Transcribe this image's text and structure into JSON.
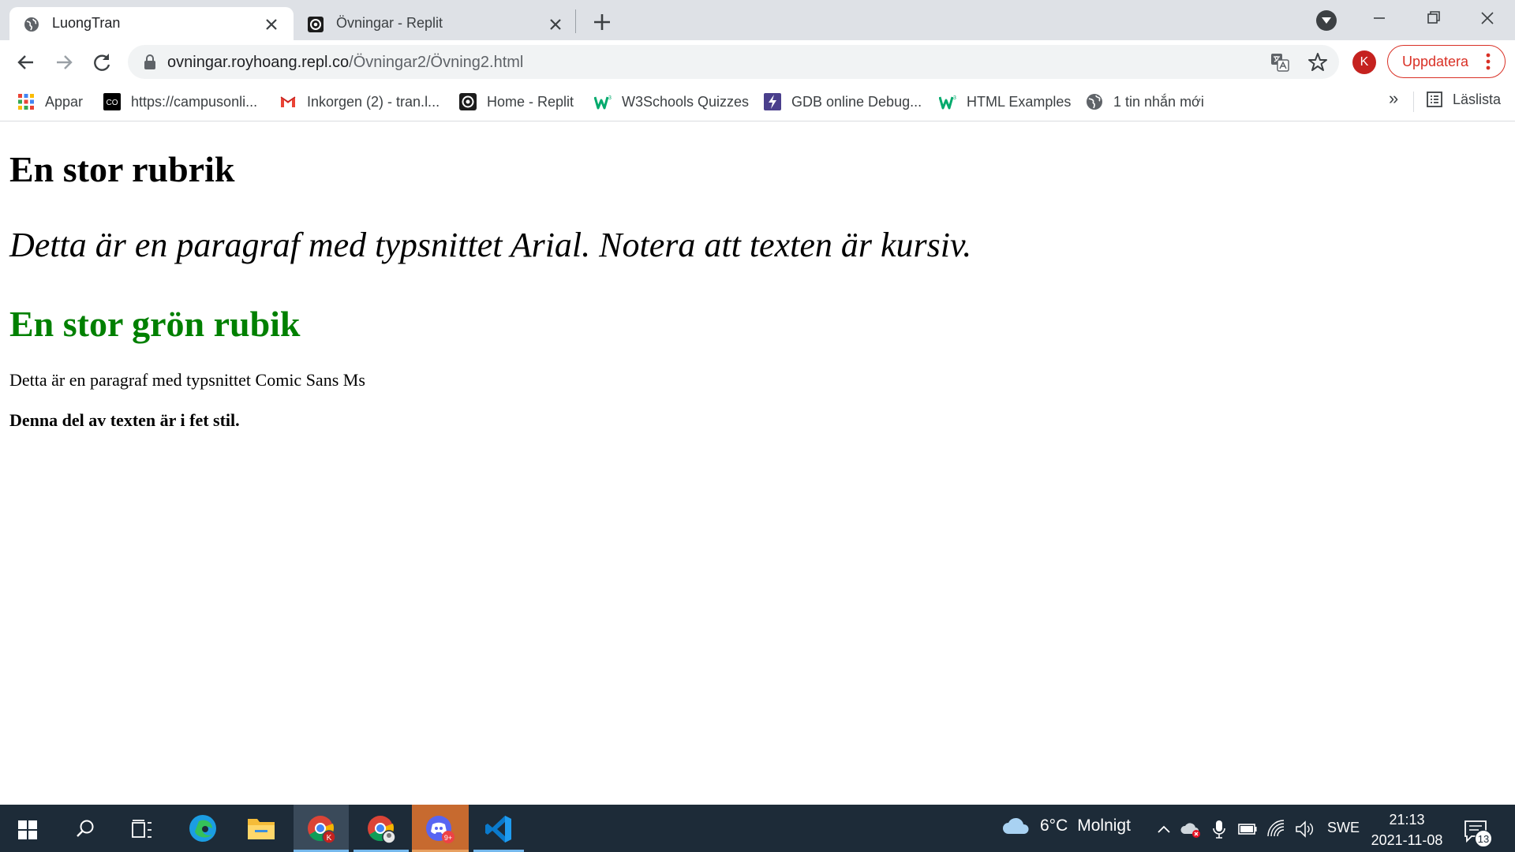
{
  "tabs": [
    {
      "title": "LuongTran",
      "icon": "globe-icon",
      "active": true
    },
    {
      "title": "Övningar - Replit",
      "icon": "replit-icon",
      "active": false
    }
  ],
  "address_bar": {
    "host": "ovningar.royhoang.repl.co",
    "path": "/Övningar2/Övning2.html"
  },
  "profile": {
    "initial": "K"
  },
  "update_button": {
    "label": "Uppdatera"
  },
  "bookmarks": [
    {
      "label": "Appar",
      "icon": "apps-grid-icon"
    },
    {
      "label": "https://campusonli...",
      "icon": "co-icon"
    },
    {
      "label": "Inkorgen (2) - tran.l...",
      "icon": "gmail-icon"
    },
    {
      "label": "Home - Replit",
      "icon": "replit-icon"
    },
    {
      "label": "W3Schools Quizzes",
      "icon": "w3schools-icon"
    },
    {
      "label": "GDB online Debug...",
      "icon": "gdb-icon"
    },
    {
      "label": "HTML Examples",
      "icon": "w3schools-icon"
    },
    {
      "label": "1 tin nhắn mới",
      "icon": "globe-icon"
    }
  ],
  "bookmarks_overflow": "»",
  "reading_list": {
    "label": "Läslista"
  },
  "page": {
    "heading1": "En stor rubrik",
    "italic_paragraph": "Detta är en paragraf med typsnittet Arial. Notera att texten är kursiv.",
    "heading2": "En stor grön rubik",
    "paragraph": "Detta är en paragraf med typsnittet Comic Sans Ms",
    "bold_paragraph": "Denna del av texten är i fet stil."
  },
  "colors": {
    "green_heading": "#008000",
    "update_red": "#d93025",
    "taskbar": "#1d2b38"
  },
  "taskbar": {
    "weather": {
      "temp": "6°C",
      "condition": "Molnigt"
    },
    "language": "SWE",
    "time": "21:13",
    "date": "2021-11-08",
    "notification_count": "13",
    "chrome_badge": "K",
    "discord_badge": "9+"
  }
}
